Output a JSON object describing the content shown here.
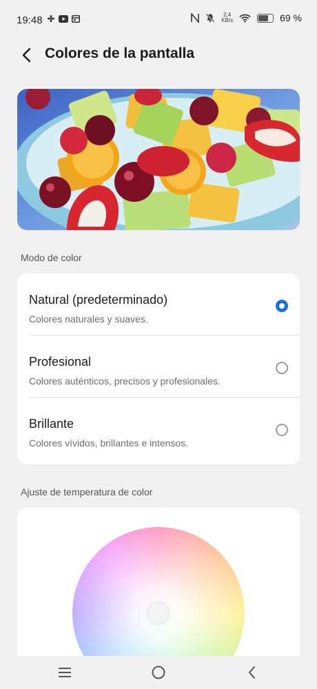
{
  "status_bar": {
    "time": "19:48",
    "net_speed_value": "2,4",
    "net_speed_unit": "KB/s",
    "battery": "69 %"
  },
  "header": {
    "title": "Colores de la pantalla"
  },
  "color_mode": {
    "section_label": "Modo de color",
    "options": [
      {
        "title": "Natural (predeterminado)",
        "subtitle": "Colores naturales y suaves.",
        "selected": true
      },
      {
        "title": "Profesional",
        "subtitle": "Colores auténticos, precisos y profesionales.",
        "selected": false
      },
      {
        "title": "Brillante",
        "subtitle": "Colores vívidos, brillantes e intensos.",
        "selected": false
      }
    ]
  },
  "temperature": {
    "section_label": "Ajuste de temperatura de color"
  },
  "colors": {
    "accent": "#1a6ee0",
    "background": "#f1f1f1",
    "card": "#ffffff"
  },
  "icons": {
    "back": "chevron-left-icon",
    "menu": "menu-icon",
    "home": "home-circle-icon",
    "nav_back": "nav-back-icon"
  }
}
